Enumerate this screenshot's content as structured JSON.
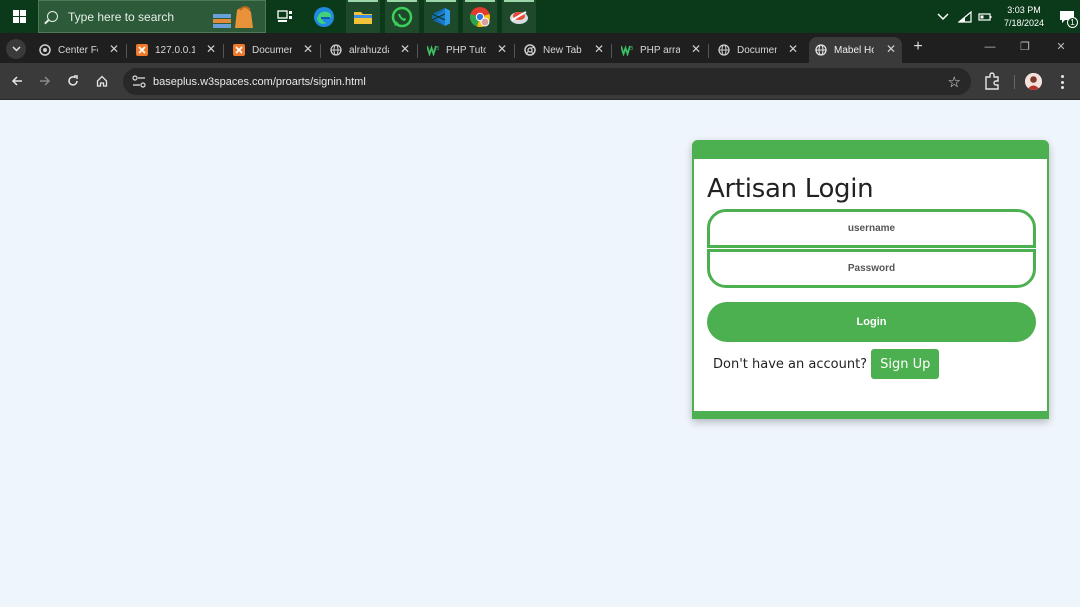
{
  "taskbar": {
    "search_placeholder": "Type here to search",
    "time": "3:03 PM",
    "date": "7/18/2024",
    "notification_count": "1",
    "pinned_icons": [
      "task-view-icon",
      "edge-icon",
      "file-explorer-icon",
      "whatsapp-icon",
      "vscode-icon",
      "chrome-icon",
      "app-icon"
    ]
  },
  "browser": {
    "tabs": [
      {
        "title": "Center Fo",
        "favicon": "chrome-settings-icon"
      },
      {
        "title": "127.0.0.1/",
        "favicon": "xampp-icon"
      },
      {
        "title": "Documen",
        "favicon": "xampp-icon"
      },
      {
        "title": "alrahuzda",
        "favicon": "globe-icon"
      },
      {
        "title": "PHP Tutor",
        "favicon": "w3schools-icon"
      },
      {
        "title": "New Tab",
        "favicon": "chrome-icon"
      },
      {
        "title": "PHP array",
        "favicon": "w3schools-icon"
      },
      {
        "title": "Documen",
        "favicon": "globe-icon"
      },
      {
        "title": "Mabel Ho",
        "favicon": "globe-icon"
      }
    ],
    "active_tab_index": 8,
    "url": "baseplus.w3spaces.com/proarts/signin.html"
  },
  "login": {
    "title": "Artisan Login",
    "username_placeholder": "username",
    "password_placeholder": "Password",
    "login_label": "Login",
    "signup_prompt": "Don't have an account?",
    "signup_label": "Sign Up"
  },
  "colors": {
    "accent": "#4caf50",
    "page_bg": "#eef5fb",
    "taskbar_bg": "#0b3a1a"
  }
}
